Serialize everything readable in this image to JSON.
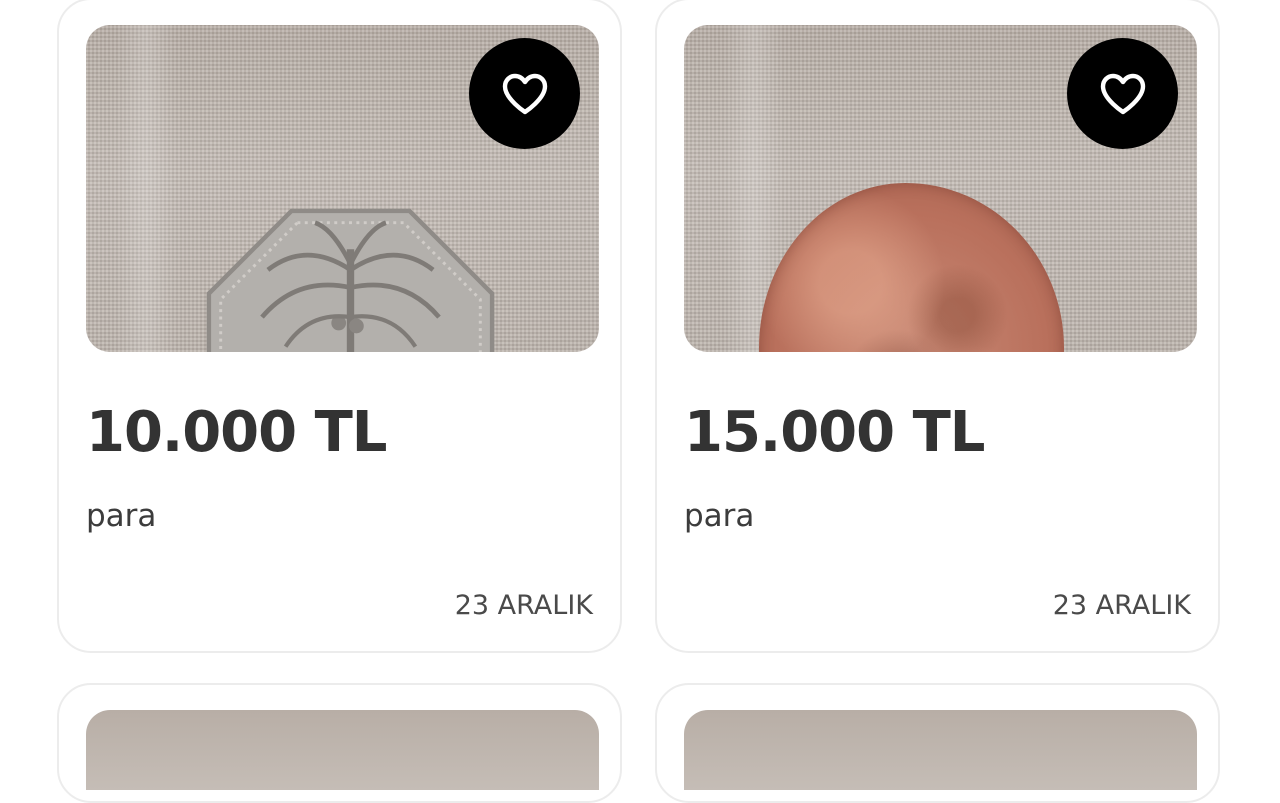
{
  "listings": [
    {
      "price": "10.000 TL",
      "title": "para",
      "date": "23 ARALIK",
      "favorite_icon": "heart-outline-icon"
    },
    {
      "price": "15.000 TL",
      "title": "para",
      "date": "23 ARALIK",
      "favorite_icon": "heart-outline-icon"
    }
  ],
  "colors": {
    "card_border": "#ececec",
    "price_text": "#333333",
    "favorite_button_bg": "#000000",
    "favorite_icon": "#ffffff"
  }
}
